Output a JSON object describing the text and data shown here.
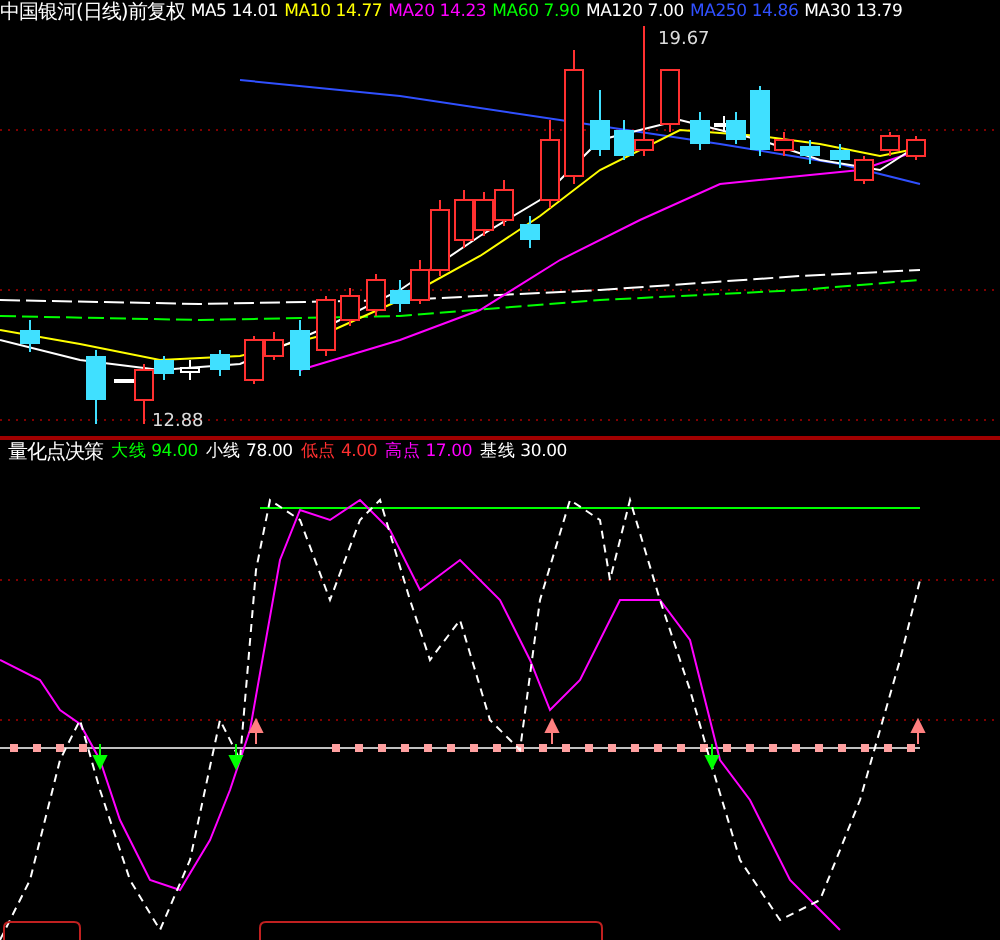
{
  "header": {
    "title": "中国银河(日线)前复权",
    "indicators": [
      {
        "label": "MA5",
        "value": "14.01",
        "color": "#ffffff"
      },
      {
        "label": "MA10",
        "value": "14.77",
        "color": "#ffff00"
      },
      {
        "label": "MA20",
        "value": "14.23",
        "color": "#ff00ff"
      },
      {
        "label": "MA60",
        "value": "7.90",
        "color": "#00ff00"
      },
      {
        "label": "MA120",
        "value": "7.00",
        "color": "#ffffff"
      },
      {
        "label": "MA250",
        "value": "14.86",
        "color": "#3050ff"
      },
      {
        "label": "MA30",
        "value": "13.79",
        "color": "#ffffff"
      }
    ]
  },
  "price_labels": [
    {
      "text": "19.67"
    },
    {
      "text": "12.88"
    }
  ],
  "indicator_panel": {
    "title": "量化点决策",
    "lines": [
      {
        "label": "大线",
        "value": "94.00",
        "color": "#00ff00"
      },
      {
        "label": "小线",
        "value": "78.00",
        "color": "#ffffff"
      },
      {
        "label": "低点",
        "value": "4.00",
        "color": "#ff3030"
      },
      {
        "label": "高点",
        "value": "17.00",
        "color": "#ff00ff"
      },
      {
        "label": "基线",
        "value": "30.00",
        "color": "#ffffff"
      }
    ]
  }
}
